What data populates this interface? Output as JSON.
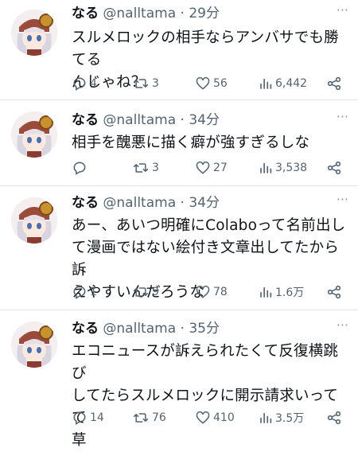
{
  "tweets": [
    {
      "name": "なる",
      "handle": "@nalltama",
      "time": "· 29分",
      "lines": [
        "スルメロックの相手ならアンバサでも勝てる",
        "んじゃね？"
      ],
      "replies": "4",
      "retweets": "3",
      "likes": "56",
      "views": "6,442"
    },
    {
      "name": "なる",
      "handle": "@nalltama",
      "time": "· 34分",
      "lines": [
        "相手を醜悪に描く癖が強すぎるしな"
      ],
      "replies": "",
      "retweets": "3",
      "likes": "27",
      "views": "3,538"
    },
    {
      "name": "なる",
      "handle": "@nalltama",
      "time": "· 34分",
      "lines": [
        "あー、あいつ明確にColaboって名前出し",
        "て漫画ではない絵付き文章出してたから訴",
        "えやすいんだろうな"
      ],
      "replies": "1",
      "retweets": "9",
      "likes": "78",
      "views": "1.6万"
    },
    {
      "name": "なる",
      "handle": "@nalltama",
      "time": "· 35分",
      "lines": [
        "エコニュースが訴えられたくて反復横跳び",
        "してたらスルメロックに開示請求いってて",
        "草"
      ],
      "replies": "14",
      "retweets": "76",
      "likes": "410",
      "views": "3.5万"
    }
  ],
  "icons": {
    "reply": "reply-icon",
    "retweet": "retweet-icon",
    "like": "heart-icon",
    "views": "views-chart-icon",
    "share": "share-icon",
    "more": "more-dots-icon"
  },
  "colors": {
    "text": "#0f1419",
    "secondary": "#536471",
    "divider": "#e1e4e8"
  }
}
